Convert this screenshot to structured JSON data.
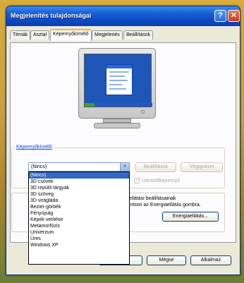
{
  "window": {
    "title": "Megjelenítés tulajdonságai",
    "help": "?",
    "close": "✕"
  },
  "tabs": [
    "Témák",
    "Asztal",
    "Képernyőkímélő",
    "Megjelenés",
    "Beállítások"
  ],
  "screensaver": {
    "group_label": "Képernyőkímélő",
    "selected": "(Nincs)",
    "settings_button": "Beállítások",
    "preview_button": "Végignézet",
    "welcome_checkbox": "Üdvözlőképernyő"
  },
  "dropdown_options": [
    "(Nincs)",
    "3D csövek",
    "3D repülő tárgyak",
    "3D szöveg",
    "3D virágláda",
    "Bezier-görbék",
    "Fényújság",
    "Képek vetítése",
    "Metamorfózis",
    "Univerzum",
    "Üres",
    "Windows XP"
  ],
  "energy": {
    "text_line1": "áellátási beállításainak",
    "text_line2": "ttintson az Energiaellátás gombra.",
    "button": "Energiaellátás..."
  },
  "footer": {
    "cancel": "Mégse",
    "apply": "Alkalmaz"
  }
}
